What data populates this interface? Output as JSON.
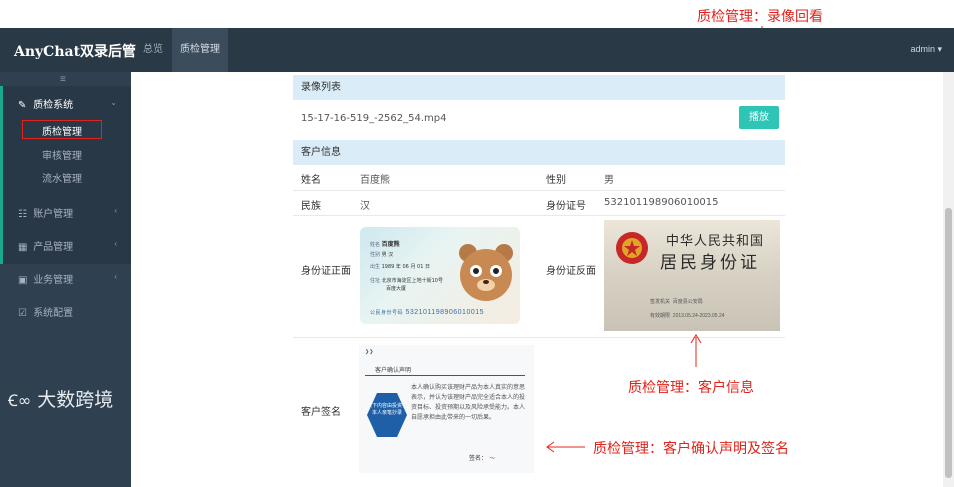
{
  "annotations": {
    "top": "质检管理：录像回看",
    "customer_info": "质检管理：客户信息",
    "signature": "质检管理：客户确认声明及签名"
  },
  "header": {
    "brand": "AnyChat双录后管",
    "nav": [
      "总览",
      "质检管理"
    ],
    "user": "admin"
  },
  "sidebar": {
    "toggle": "≡",
    "groups": [
      {
        "label": "质检系统",
        "icon": "wrench-icon",
        "children": [
          "质检管理",
          "审核管理",
          "流水管理"
        ]
      },
      {
        "label": "账户管理",
        "icon": "users-icon"
      },
      {
        "label": "产品管理",
        "icon": "grid-icon"
      },
      {
        "label": "业务管理",
        "icon": "briefcase-icon"
      },
      {
        "label": "系统配置",
        "icon": "edit-icon"
      }
    ]
  },
  "logo": "大数跨境",
  "video_section": {
    "header": "录像列表",
    "filename": "15-17-16-519_-2562_54.mp4",
    "play_label": "播放"
  },
  "customer_section": {
    "header": "客户信息",
    "name_label": "姓名",
    "name_value": "百度熊",
    "gender_label": "性别",
    "gender_value": "男",
    "ethnicity_label": "民族",
    "ethnicity_value": "汉",
    "id_label": "身份证号",
    "id_value": "532101198906010015",
    "id_front_label": "身份证正面",
    "id_back_label": "身份证反面",
    "sign_label": "客户签名"
  },
  "id_front": {
    "name": "百度熊",
    "gender_ethnicity": "男    汉",
    "birth": "1989 年 06 月 01 日",
    "address1": "北京市海淀区上地十街10号",
    "address2": "百度大厦",
    "number_label": "公民身份号码",
    "number": "532101198906010015"
  },
  "id_back": {
    "line1": "中华人民共和国",
    "line2": "居民身份证",
    "authority_label": "签发机关",
    "authority": "百度县公安局",
    "validity_label": "有效期限",
    "validity": "2013.05.24-2023.05.24"
  },
  "sig_doc": {
    "title": "客户确认声明",
    "hex_text": "以下内容由投资者本人亲笔抄录",
    "body": "本人确认购买该理财产品为本人真实的意思表示，并认为该理财产品完全适合本人的投资目标、投资预期以及风险承受能力。本人自愿承担由此带来的一切后果。",
    "sign": "签名："
  },
  "colors": {
    "annotation": "#e0241b",
    "topbar": "#2a3946",
    "sidebar": "#2f4050",
    "accent": "#19aa8d",
    "play": "#2ec4b6",
    "panel_header": "#d9ecf7"
  }
}
